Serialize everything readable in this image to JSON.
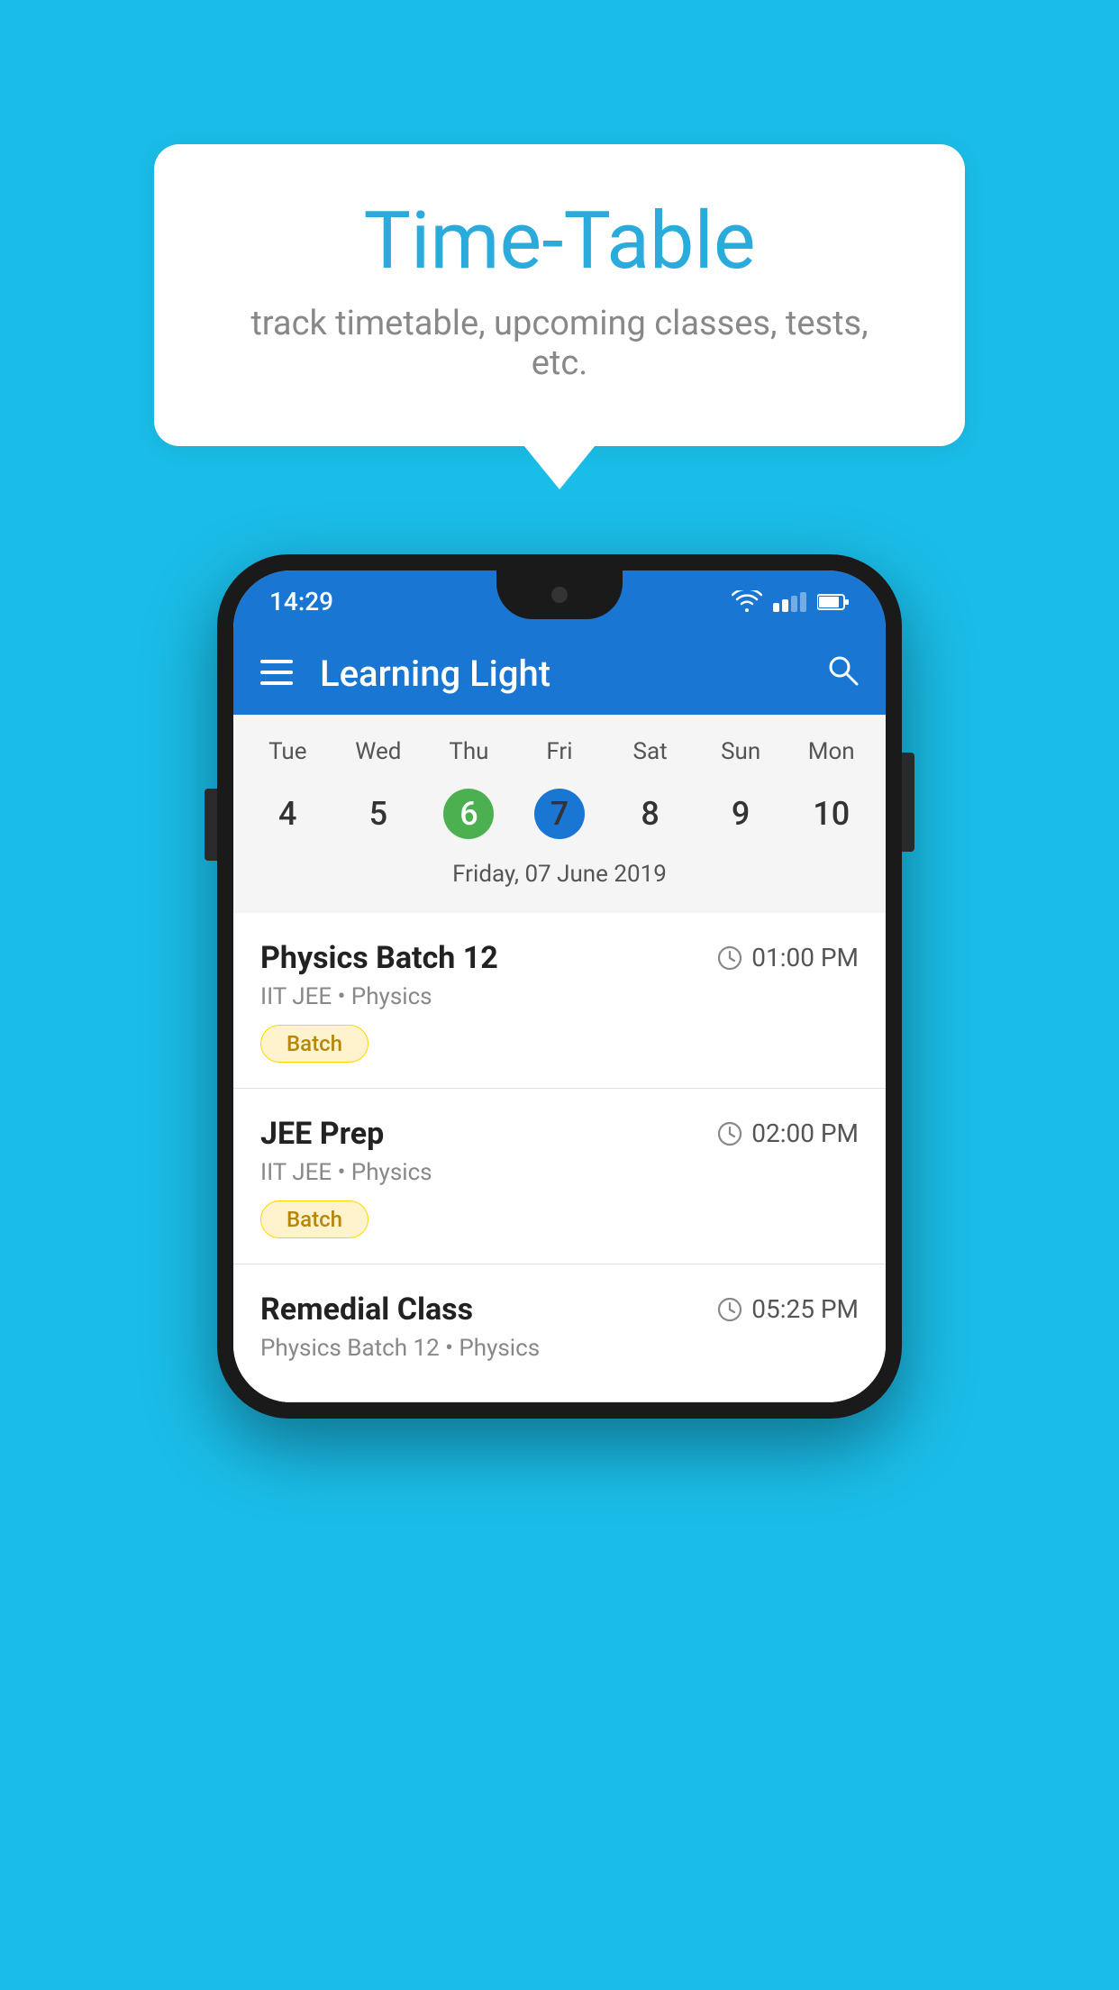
{
  "background_color": "#1ABDE8",
  "speech_bubble": {
    "title": "Time-Table",
    "subtitle": "track timetable, upcoming classes, tests, etc."
  },
  "phone": {
    "status_bar": {
      "time": "14:29"
    },
    "app_bar": {
      "title": "Learning Light"
    },
    "calendar": {
      "days_of_week": [
        "Tue",
        "Wed",
        "Thu",
        "Fri",
        "Sat",
        "Sun",
        "Mon"
      ],
      "dates": [
        "4",
        "5",
        "6",
        "7",
        "8",
        "9",
        "10"
      ],
      "today_index": 2,
      "selected_index": 3,
      "selected_date_label": "Friday, 07 June 2019"
    },
    "schedule_items": [
      {
        "title": "Physics Batch 12",
        "time": "01:00 PM",
        "subtitle": "IIT JEE • Physics",
        "badge": "Batch"
      },
      {
        "title": "JEE Prep",
        "time": "02:00 PM",
        "subtitle": "IIT JEE • Physics",
        "badge": "Batch"
      },
      {
        "title": "Remedial Class",
        "time": "05:25 PM",
        "subtitle": "Physics Batch 12 • Physics",
        "badge": null
      }
    ]
  }
}
